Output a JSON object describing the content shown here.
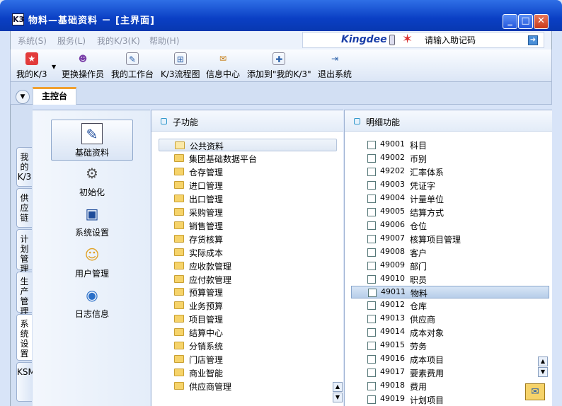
{
  "window": {
    "title": "物料—基础资料 － [主界面]",
    "app_icon": "K3",
    "controls": [
      "_",
      "□",
      "✕"
    ]
  },
  "menu": {
    "items": [
      "系统(S)",
      "服务(L)",
      "我的K/3(K)",
      "帮助(H)"
    ],
    "brand": "Kingdee",
    "memo_placeholder": "请输入助记码"
  },
  "toolbar": {
    "buttons": [
      {
        "label": "我的K/3",
        "icon": "star-icon"
      },
      {
        "label": "更换操作员",
        "icon": "users-icon"
      },
      {
        "label": "我的工作台",
        "icon": "pen-icon"
      },
      {
        "label": "K/3流程图",
        "icon": "flowchart-icon"
      },
      {
        "label": "信息中心",
        "icon": "message-icon"
      },
      {
        "label": "添加到\"我的K/3\"",
        "icon": "add-favorite-icon"
      },
      {
        "label": "退出系统",
        "icon": "exit-icon"
      }
    ]
  },
  "tabs": {
    "main": "主控台"
  },
  "side_tabs": [
    "我的K/3",
    "供应链",
    "计划管理",
    "生产管理",
    "系统设置",
    "KSM"
  ],
  "categories": [
    {
      "label": "基础资料",
      "icon": "basic-data-icon"
    },
    {
      "label": "初始化",
      "icon": "gear-init-icon"
    },
    {
      "label": "系统设置",
      "icon": "monitor-settings-icon"
    },
    {
      "label": "用户管理",
      "icon": "user-management-icon"
    },
    {
      "label": "日志信息",
      "icon": "log-globe-icon"
    }
  ],
  "sub_panel": {
    "header": "子功能",
    "items": [
      "公共资料",
      "集团基础数据平台",
      "仓存管理",
      "进口管理",
      "出口管理",
      "采购管理",
      "销售管理",
      "存货核算",
      "实际成本",
      "应收款管理",
      "应付款管理",
      "预算管理",
      "业务预算",
      "项目管理",
      "结算中心",
      "分销系统",
      "门店管理",
      "商业智能",
      "供应商管理"
    ]
  },
  "detail_panel": {
    "header": "明细功能",
    "items": [
      {
        "code": "49001",
        "name": "科目"
      },
      {
        "code": "49002",
        "name": "币别"
      },
      {
        "code": "49202",
        "name": "汇率体系"
      },
      {
        "code": "49003",
        "name": "凭证字"
      },
      {
        "code": "49004",
        "name": "计量单位"
      },
      {
        "code": "49005",
        "name": "结算方式"
      },
      {
        "code": "49006",
        "name": "仓位"
      },
      {
        "code": "49007",
        "name": "核算项目管理"
      },
      {
        "code": "49008",
        "name": "客户"
      },
      {
        "code": "49009",
        "name": "部门"
      },
      {
        "code": "49010",
        "name": "职员"
      },
      {
        "code": "49011",
        "name": "物料"
      },
      {
        "code": "49012",
        "name": "仓库"
      },
      {
        "code": "49013",
        "name": "供应商"
      },
      {
        "code": "49014",
        "name": "成本对象"
      },
      {
        "code": "49015",
        "name": "劳务"
      },
      {
        "code": "49016",
        "name": "成本项目"
      },
      {
        "code": "49017",
        "name": "要素费用"
      },
      {
        "code": "49018",
        "name": "费用"
      },
      {
        "code": "49019",
        "name": "计划项目"
      }
    ]
  },
  "colors": {
    "titlebar": "#0a3fc4",
    "workspace": "#d8e4f8",
    "selected_row": "#b7cde9",
    "folder": "#f6d36a"
  }
}
